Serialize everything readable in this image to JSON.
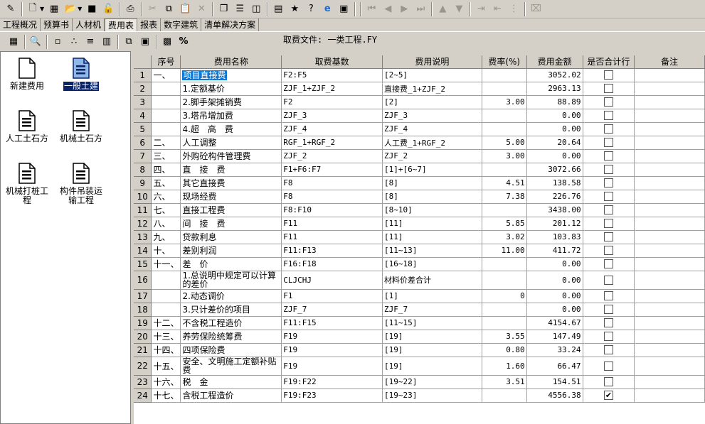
{
  "toolbar1": {
    "icons": [
      "edit-icon",
      "new-icon",
      "copy-doc-icon",
      "open-icon",
      "save-icon",
      "unlock-icon",
      "cut-icon",
      "copy-icon",
      "paste-icon",
      "delete-icon",
      "insert-row-icon",
      "insert-col-icon",
      "window-icon",
      "calculator-icon",
      "star-icon",
      "help-icon",
      "ie-icon",
      "print-preview-icon",
      "first-icon",
      "prev-icon",
      "next-icon",
      "last-icon",
      "up-icon",
      "down-icon",
      "indent-icon",
      "outdent-icon",
      "tree-icon",
      "clear-icon"
    ]
  },
  "tabs": [
    "工程概况",
    "预算书",
    "人材机",
    "费用表",
    "报表",
    "数字建筑",
    "清单解决方案"
  ],
  "active_tab": "费用表",
  "fee_file": "取费文件: 一类工程.FY",
  "left_panel": {
    "items": [
      {
        "label": "新建费用",
        "selected": false
      },
      {
        "label": "一般土建",
        "selected": true
      },
      {
        "label": "人工土石方",
        "selected": false
      },
      {
        "label": "机械土石方",
        "selected": false
      },
      {
        "label": "机械打桩工程",
        "selected": false
      },
      {
        "label": "构件吊装运输工程",
        "selected": false
      }
    ]
  },
  "table": {
    "headers": [
      "",
      "序号",
      "费用名称",
      "取费基数",
      "费用说明",
      "费率(%)",
      "费用金额",
      "是否合计行",
      "备注"
    ],
    "rows": [
      {
        "n": "1",
        "seq": "一、",
        "name": "项目直接费",
        "base": "F2:F5",
        "desc": "[2~5]",
        "rate": "",
        "amount": "3052.02",
        "total": false
      },
      {
        "n": "2",
        "seq": "",
        "name": "1.定额基价",
        "base": "ZJF_1+ZJF_2",
        "desc": "直接费_1+ZJF_2",
        "rate": "",
        "amount": "2963.13",
        "total": false
      },
      {
        "n": "3",
        "seq": "",
        "name": "2.脚手架摊销费",
        "base": "F2",
        "desc": "[2]",
        "rate": "3.00",
        "amount": "88.89",
        "total": false
      },
      {
        "n": "4",
        "seq": "",
        "name": "3.塔吊增加费",
        "base": "ZJF_3",
        "desc": "ZJF_3",
        "rate": "",
        "amount": "0.00",
        "total": false
      },
      {
        "n": "5",
        "seq": "",
        "name": "4.超　高　费",
        "base": "ZJF_4",
        "desc": "ZJF_4",
        "rate": "",
        "amount": "0.00",
        "total": false
      },
      {
        "n": "6",
        "seq": "二、",
        "name": "人工调整",
        "base": "RGF_1+RGF_2",
        "desc": "人工费_1+RGF_2",
        "rate": "5.00",
        "amount": "20.64",
        "total": false
      },
      {
        "n": "7",
        "seq": "三、",
        "name": "外购砼构件管理费",
        "base": "ZJF_2",
        "desc": "ZJF_2",
        "rate": "3.00",
        "amount": "0.00",
        "total": false
      },
      {
        "n": "8",
        "seq": "四、",
        "name": "直　接　费",
        "base": "F1+F6:F7",
        "desc": "[1]+[6~7]",
        "rate": "",
        "amount": "3072.66",
        "total": false
      },
      {
        "n": "9",
        "seq": "五、",
        "name": "其它直接费",
        "base": "F8",
        "desc": "[8]",
        "rate": "4.51",
        "amount": "138.58",
        "total": false
      },
      {
        "n": "10",
        "seq": "六、",
        "name": "现场经费",
        "base": "F8",
        "desc": "[8]",
        "rate": "7.38",
        "amount": "226.76",
        "total": false
      },
      {
        "n": "11",
        "seq": "七、",
        "name": "直接工程费",
        "base": "F8:F10",
        "desc": "[8~10]",
        "rate": "",
        "amount": "3438.00",
        "total": false
      },
      {
        "n": "12",
        "seq": "八、",
        "name": "间　接　费",
        "base": "F11",
        "desc": "[11]",
        "rate": "5.85",
        "amount": "201.12",
        "total": false
      },
      {
        "n": "13",
        "seq": "九、",
        "name": "贷款利息",
        "base": "F11",
        "desc": "[11]",
        "rate": "3.02",
        "amount": "103.83",
        "total": false
      },
      {
        "n": "14",
        "seq": "十、",
        "name": "差别利润",
        "base": "F11:F13",
        "desc": "[11~13]",
        "rate": "11.00",
        "amount": "411.72",
        "total": false
      },
      {
        "n": "15",
        "seq": "十一、",
        "name": "差　价",
        "base": "F16:F18",
        "desc": "[16~18]",
        "rate": "",
        "amount": "0.00",
        "total": false
      },
      {
        "n": "16",
        "seq": "",
        "name": "1.总说明中规定可以计算的差价",
        "base": "CLJCHJ",
        "desc": "材料价差合计",
        "rate": "",
        "amount": "0.00",
        "total": false
      },
      {
        "n": "17",
        "seq": "",
        "name": "2.动态调价",
        "base": "F1",
        "desc": "[1]",
        "rate": "0",
        "amount": "0.00",
        "total": false
      },
      {
        "n": "18",
        "seq": "",
        "name": "3.只计差价的项目",
        "base": "ZJF_7",
        "desc": "ZJF_7",
        "rate": "",
        "amount": "0.00",
        "total": false
      },
      {
        "n": "19",
        "seq": "十二、",
        "name": "不含税工程造价",
        "base": "F11:F15",
        "desc": "[11~15]",
        "rate": "",
        "amount": "4154.67",
        "total": false
      },
      {
        "n": "20",
        "seq": "十三、",
        "name": "养劳保险统筹费",
        "base": "F19",
        "desc": "[19]",
        "rate": "3.55",
        "amount": "147.49",
        "total": false
      },
      {
        "n": "21",
        "seq": "十四、",
        "name": "四项保险费",
        "base": "F19",
        "desc": "[19]",
        "rate": "0.80",
        "amount": "33.24",
        "total": false
      },
      {
        "n": "22",
        "seq": "十五、",
        "name": "安全、文明施工定额补贴费",
        "base": "F19",
        "desc": "[19]",
        "rate": "1.60",
        "amount": "66.47",
        "total": false
      },
      {
        "n": "23",
        "seq": "十六、",
        "name": "税　金",
        "base": "F19:F22",
        "desc": "[19~22]",
        "rate": "3.51",
        "amount": "154.51",
        "total": false
      },
      {
        "n": "24",
        "seq": "十七、",
        "name": "含税工程造价",
        "base": "F19:F23",
        "desc": "[19~23]",
        "rate": "",
        "amount": "4556.38",
        "total": true
      }
    ]
  }
}
